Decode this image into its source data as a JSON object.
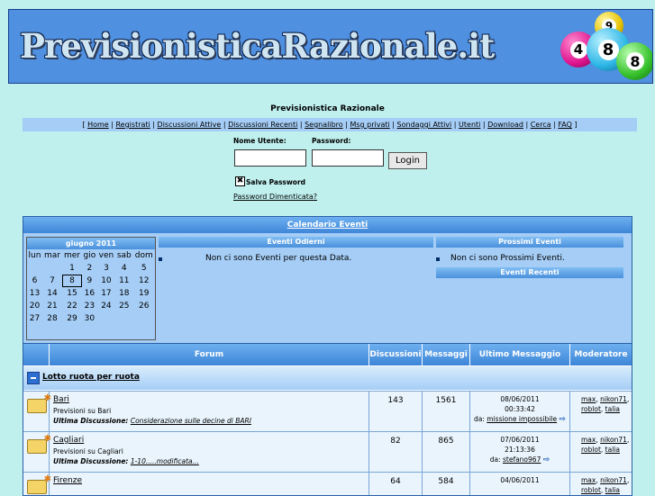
{
  "banner": {
    "title": "PrevisionisticaRazionale.it",
    "balls": [
      "9",
      "4",
      "8",
      "8",
      "9"
    ]
  },
  "site_title": "Previsionistica Razionale",
  "nav": {
    "items": [
      "Home",
      "Registrati",
      "Discussioni Attive",
      "Discussioni Recenti",
      "Segnalibro",
      "Msg privati",
      "Sondaggi Attivi",
      "Utenti",
      "Download",
      "Cerca",
      "FAQ"
    ]
  },
  "login": {
    "username_label": "Nome Utente:",
    "password_label": "Password:",
    "username_value": "",
    "password_value": "",
    "button_label": "Login",
    "save_password_label": "Salva Password",
    "save_password_checked": "✖",
    "forgot_password": "Password Dimenticata?"
  },
  "calendar": {
    "title": "Calendario Eventi",
    "month": "giugno 2011",
    "weekdays": [
      "lun",
      "mar",
      "mer",
      "gio",
      "ven",
      "sab",
      "dom"
    ],
    "weeks": [
      [
        "",
        "",
        "1",
        "2",
        "3",
        "4",
        "5"
      ],
      [
        "6",
        "7",
        "8",
        "9",
        "10",
        "11",
        "12"
      ],
      [
        "13",
        "14",
        "15",
        "16",
        "17",
        "18",
        "19"
      ],
      [
        "20",
        "21",
        "22",
        "23",
        "24",
        "25",
        "26"
      ],
      [
        "27",
        "28",
        "29",
        "30",
        "",
        "",
        ""
      ]
    ],
    "today": "8",
    "today_events_title": "Eventi Odierni",
    "today_events_text": "Non ci sono Eventi per questa Data.",
    "next_events_title": "Prossimi Eventi",
    "next_events_text": "Non ci sono Prossimi Eventi.",
    "recent_events_title": "Eventi Recenti"
  },
  "forum_table": {
    "headers": [
      "Forum",
      "Discussioni",
      "Messaggi",
      "Ultimo Messaggio",
      "Moderatore"
    ],
    "category": "Lotto ruota per ruota",
    "last_topic_label": "Ultima Discussione:",
    "from_label": "da:",
    "rows": [
      {
        "name": "Bari",
        "desc": "Previsioni su Bari",
        "last_topic": "Considerazione sulle decine di BARI",
        "topics": "143",
        "posts": "1561",
        "last_date": "08/06/2011",
        "last_time": "00:33:42",
        "last_user": "missione impossibile",
        "mods": [
          "max",
          "nikon71",
          "roblot",
          "talia"
        ]
      },
      {
        "name": "Cagliari",
        "desc": "Previsioni su Cagliari",
        "last_topic": "1-10.....modificata...",
        "topics": "82",
        "posts": "865",
        "last_date": "07/06/2011",
        "last_time": "21:13:36",
        "last_user": "stefano967",
        "mods": [
          "max",
          "nikon71",
          "roblot",
          "talia"
        ]
      },
      {
        "name": "Firenze",
        "desc": "",
        "last_topic": "",
        "topics": "64",
        "posts": "584",
        "last_date": "04/06/2011",
        "last_time": "",
        "last_user": "",
        "mods": [
          "max",
          "nikon71",
          "roblot",
          "talia"
        ]
      }
    ]
  },
  "colors": {
    "page_bg": "#bff0ee",
    "header_blue": "#3d86d8",
    "light_blue": "#a5cdf6",
    "row_bg": "#e9f4fc"
  }
}
